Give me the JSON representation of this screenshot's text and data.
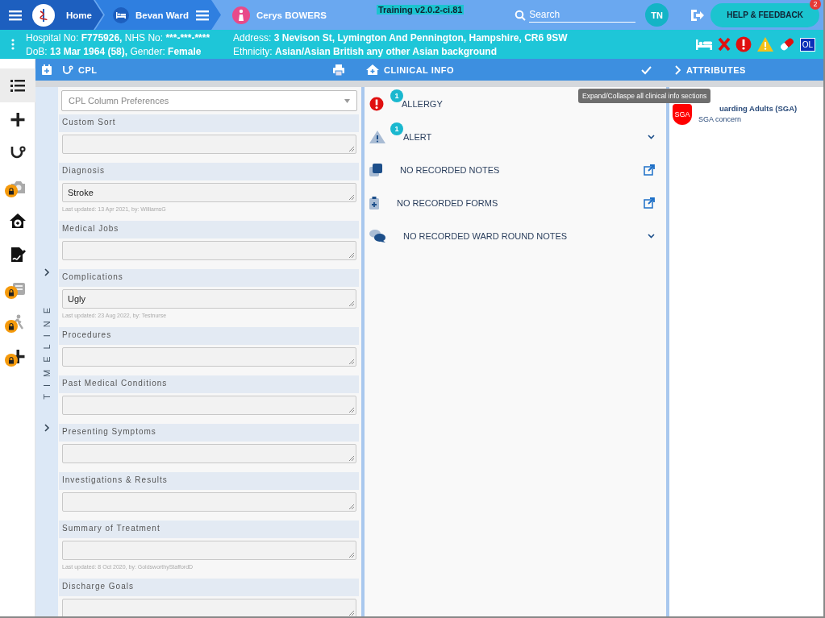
{
  "topbar": {
    "crumbs": [
      {
        "kind": "home",
        "label": "Home"
      },
      {
        "kind": "ward",
        "label": "Bevan Ward"
      },
      {
        "kind": "patient",
        "label": "Cerys BOWERS"
      }
    ],
    "version": "Training v2.0.2-ci.81",
    "search": {
      "placeholder": "Search"
    },
    "user_initials": "TN",
    "help": {
      "label": "HELP & FEEDBACK",
      "badge": "2"
    }
  },
  "patient": {
    "lines": [
      [
        {
          "label": "Hospital No:",
          "value": "F775926,"
        },
        {
          "label": "NHS No:",
          "value": "***-***-****"
        }
      ],
      [
        {
          "label": "DoB:",
          "value": "13 Mar 1964 (58),"
        },
        {
          "label": "Gender:",
          "value": "Female"
        }
      ],
      [
        {
          "label": "Address:",
          "value": "3 Nevison St, Lymington And Pennington, Hampshire, CR6 9SW"
        }
      ],
      [
        {
          "label": "Ethnicity:",
          "value": "Asian/Asian British any other Asian background"
        }
      ]
    ],
    "flags": [
      {
        "kind": "bed"
      },
      {
        "kind": "cross"
      },
      {
        "kind": "allergy"
      },
      {
        "kind": "alert"
      },
      {
        "kind": "pill"
      },
      {
        "kind": "text",
        "label": "OL"
      }
    ]
  },
  "rail": [
    {
      "kind": "list",
      "selected": true,
      "locked": false
    },
    {
      "kind": "plus",
      "selected": false,
      "locked": false
    },
    {
      "kind": "stethoscope",
      "selected": false,
      "locked": false
    },
    {
      "kind": "camera",
      "selected": false,
      "locked": true
    },
    {
      "kind": "home",
      "selected": false,
      "locked": false
    },
    {
      "kind": "sign",
      "selected": false,
      "locked": false
    },
    {
      "kind": "clipboard",
      "selected": false,
      "locked": true
    },
    {
      "kind": "walk",
      "selected": false,
      "locked": true
    },
    {
      "kind": "plus",
      "selected": false,
      "locked": true
    }
  ],
  "timeline": {
    "title": "TIMELINE"
  },
  "cpl": {
    "title": "CPL",
    "preferences": {
      "placeholder": "CPL Column Preferences"
    },
    "sections": [
      {
        "label": "Custom Sort"
      },
      {
        "label": "Diagnosis",
        "value": "Stroke",
        "updated": "Last updated: 13 Apr 2021, by: WilliamsG"
      },
      {
        "label": "Medical Jobs"
      },
      {
        "label": "Complications",
        "value": "Ugly",
        "updated": "Last updated: 23 Aug 2022, by: Testnurse"
      },
      {
        "label": "Procedures"
      },
      {
        "label": "Past Medical Conditions"
      },
      {
        "label": "Presenting Symptoms"
      },
      {
        "label": "Investigations & Results"
      },
      {
        "label": "Summary of Treatment",
        "updated": "Last updated: 8 Oct 2020, by: GoldsworthyStaffordD"
      },
      {
        "label": "Discharge Goals"
      }
    ]
  },
  "clinical": {
    "title": "CLINICAL INFO",
    "tooltip": "Expand/Collaspe all clinical info sections",
    "rows": [
      {
        "kind": "allergy",
        "label": "ALLERGY",
        "badge": "1",
        "expandable": false,
        "external_link": false
      },
      {
        "kind": "alert",
        "label": "ALERT",
        "badge": "1",
        "expandable": true,
        "external_link": false
      },
      {
        "kind": "notes",
        "label": "NO RECORDED NOTES",
        "expandable": false,
        "external_link": true
      },
      {
        "kind": "forms",
        "label": "NO RECORDED FORMS",
        "expandable": false,
        "external_link": true
      },
      {
        "kind": "ward",
        "label": "NO RECORDED WARD ROUND NOTES",
        "expandable": true,
        "external_link": false
      }
    ]
  },
  "attributes": {
    "title": "ATTRIBUTES",
    "items": [
      {
        "badge": "SGA",
        "title": "uarding Adults (SGA)",
        "subtitle": "SGA concern"
      }
    ]
  }
}
